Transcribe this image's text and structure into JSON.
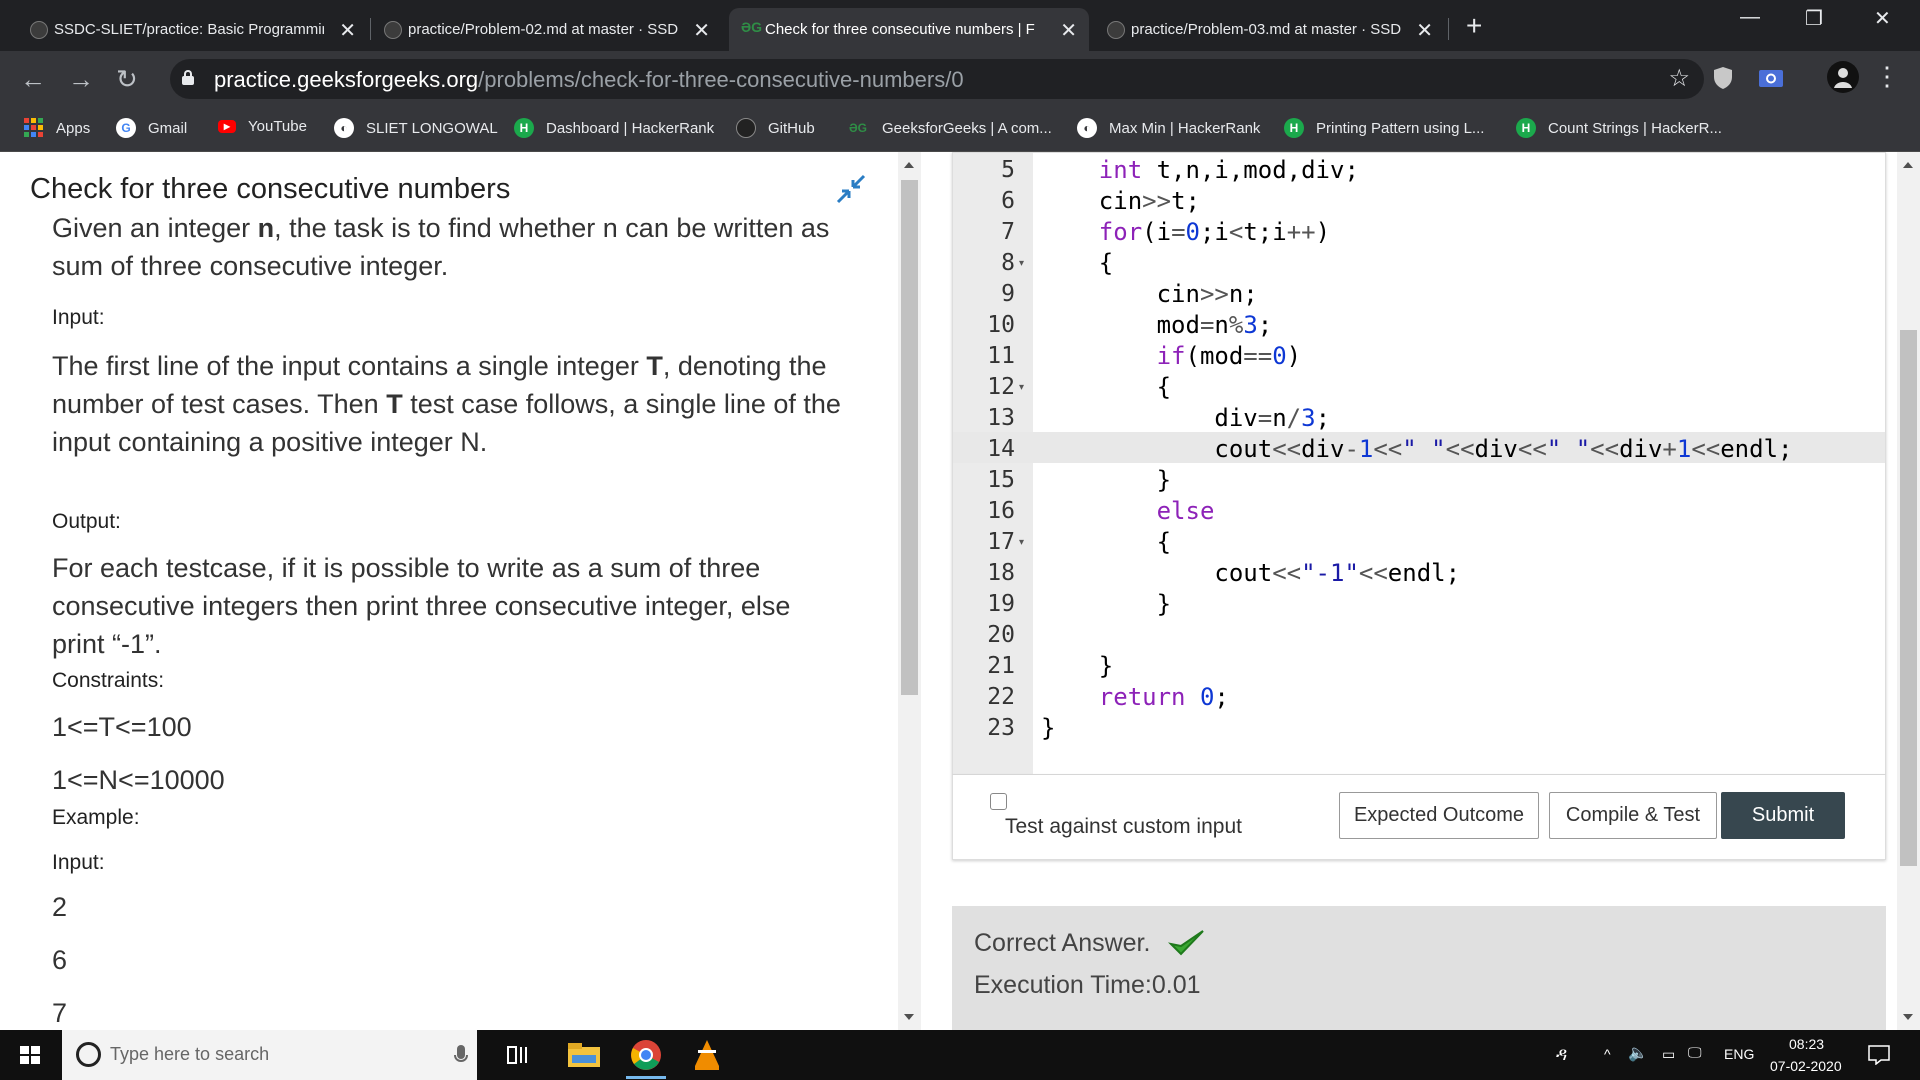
{
  "browser": {
    "tabs": [
      {
        "title": "SSDC-SLIET/practice: Basic Programmin",
        "active": false
      },
      {
        "title": "practice/Problem-02.md at master · SSD",
        "active": false
      },
      {
        "title": "Check for three consecutive numbers | F",
        "active": true
      },
      {
        "title": "practice/Problem-03.md at master · SSD",
        "active": false
      }
    ],
    "new_tab_icon": "+",
    "window_controls": {
      "minimize": "—",
      "restore": "❐",
      "close": "✕"
    },
    "url_host": "practice.geeksforgeeks.org",
    "url_path": "/problems/check-for-three-consecutive-numbers/0",
    "bookmarks": [
      {
        "label": "Apps",
        "icon": "apps-icon"
      },
      {
        "label": "Gmail",
        "icon": "google-icon"
      },
      {
        "label": "YouTube",
        "icon": "youtube-icon"
      },
      {
        "label": "SLIET LONGOWAL",
        "icon": "globe-icon"
      },
      {
        "label": "Dashboard | HackerRank",
        "icon": "hackerrank-icon"
      },
      {
        "label": "GitHub",
        "icon": "github-icon"
      },
      {
        "label": "GeeksforGeeks | A com...",
        "icon": "gfg-icon"
      },
      {
        "label": "Max Min | HackerRank",
        "icon": "globe-icon"
      },
      {
        "label": "Printing Pattern using L...",
        "icon": "hackerrank-icon"
      },
      {
        "label": "Count Strings | HackerR...",
        "icon": "hackerrank-icon"
      }
    ]
  },
  "problem": {
    "title": "Check for three consecutive numbers",
    "statement_a": "Given an integer ",
    "statement_n": "n",
    "statement_b": ", the task is to find whether n can be written as sum of three consecutive integer.",
    "input_label": "Input:",
    "input_a": "The first line of the input contains a single integer ",
    "input_t1": "T",
    "input_b": ", denoting the number of test cases. Then ",
    "input_t2": "T",
    "input_c": " test case follows, a single line of the input containing a positive integer N.",
    "output_label": "Output:",
    "output_text": "For each testcase, if it is possible to write as a sum of three consecutive integers  then print three consecutive integer, else print “-1”.",
    "constraints_label": "Constraints:",
    "constraint_1": "1<=T<=100",
    "constraint_2": "1<=N<=10000",
    "example_label": "Example:",
    "example_input_label": "Input:",
    "example_values": [
      "2",
      "6",
      "7"
    ]
  },
  "editor": {
    "lines": [
      {
        "n": "5",
        "fold": false
      },
      {
        "n": "6",
        "fold": false
      },
      {
        "n": "7",
        "fold": false
      },
      {
        "n": "8",
        "fold": true
      },
      {
        "n": "9",
        "fold": false
      },
      {
        "n": "10",
        "fold": false
      },
      {
        "n": "11",
        "fold": false
      },
      {
        "n": "12",
        "fold": true
      },
      {
        "n": "13",
        "fold": false
      },
      {
        "n": "14",
        "fold": false
      },
      {
        "n": "15",
        "fold": false
      },
      {
        "n": "16",
        "fold": false
      },
      {
        "n": "17",
        "fold": true
      },
      {
        "n": "18",
        "fold": false
      },
      {
        "n": "19",
        "fold": false
      },
      {
        "n": "20",
        "fold": false
      },
      {
        "n": "21",
        "fold": false
      },
      {
        "n": "22",
        "fold": false
      },
      {
        "n": "23",
        "fold": false
      }
    ],
    "code": [
      "    int t,n,i,mod,div;",
      "    cin>>t;",
      "    for(i=0;i<t;i++)",
      "    {",
      "        cin>>n;",
      "        mod=n%3;",
      "        if(mod==0)",
      "        {",
      "            div=n/3;",
      "            cout<<div-1<<\" \"<<div<<\" \"<<div+1<<endl;",
      "        }",
      "        else",
      "        {",
      "            cout<<\"-1\"<<endl;",
      "        }",
      "",
      "    }",
      "    return 0;",
      "}"
    ]
  },
  "actions": {
    "custom_input_label": "Test against custom input",
    "expected_outcome": "Expected Outcome",
    "compile_test": "Compile & Test",
    "submit": "Submit"
  },
  "result": {
    "status": "Correct Answer.",
    "execution_time": "Execution Time:0.01"
  },
  "taskbar": {
    "search_placeholder": "Type here to search",
    "language": "ENG",
    "time": "08:23",
    "date": "07-02-2020"
  },
  "colors": {
    "keyword": "#8d22b8",
    "number": "#0d37d4",
    "submit_bg": "#37474f",
    "gfg_green": "#2f8d46",
    "check_green": "#3aa832"
  }
}
